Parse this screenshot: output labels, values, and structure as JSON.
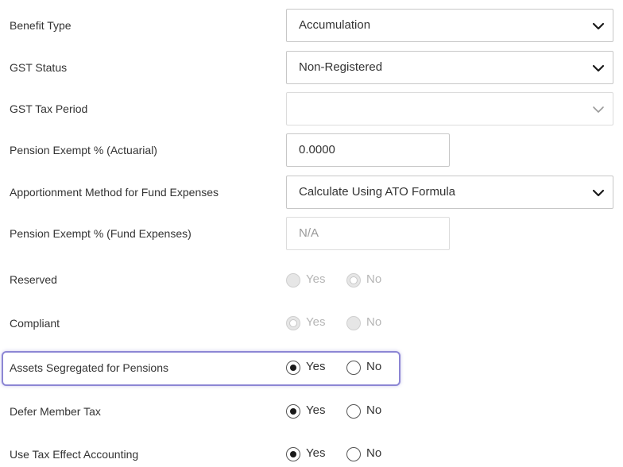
{
  "benefit_type": {
    "label": "Benefit Type",
    "value": "Accumulation",
    "icon": "chevron-down-icon"
  },
  "gst_status": {
    "label": "GST Status",
    "value": "Non-Registered",
    "icon": "chevron-down-icon"
  },
  "gst_tax_period": {
    "label": "GST Tax Period",
    "value": "",
    "disabled": true,
    "icon": "chevron-down-icon"
  },
  "pension_exempt_actuarial": {
    "label": "Pension Exempt % (Actuarial)",
    "value": "0.0000"
  },
  "apportionment_method": {
    "label": "Apportionment Method for Fund Expenses",
    "value": "Calculate Using ATO Formula",
    "icon": "chevron-down-icon"
  },
  "pension_exempt_fund_expenses": {
    "label": "Pension Exempt % (Fund Expenses)",
    "value": "N/A",
    "disabled": true
  },
  "reserved": {
    "label": "Reserved",
    "yes": "Yes",
    "no": "No",
    "selected": "No",
    "disabled": true
  },
  "compliant": {
    "label": "Compliant",
    "yes": "Yes",
    "no": "No",
    "selected": "Yes",
    "disabled": true
  },
  "assets_segregated": {
    "label": "Assets Segregated for Pensions",
    "yes": "Yes",
    "no": "No",
    "selected": "Yes",
    "disabled": false,
    "focused": true
  },
  "defer_member_tax": {
    "label": "Defer Member Tax",
    "yes": "Yes",
    "no": "No",
    "selected": "Yes",
    "disabled": false
  },
  "tax_effect_accounting": {
    "label": "Use Tax Effect Accounting",
    "yes": "Yes",
    "no": "No",
    "selected": "Yes",
    "disabled": false
  },
  "colors": {
    "focus_ring": "#8c86d4",
    "border": "#c7c7c7",
    "text": "#333333",
    "disabled_text": "#b5b5b5"
  }
}
